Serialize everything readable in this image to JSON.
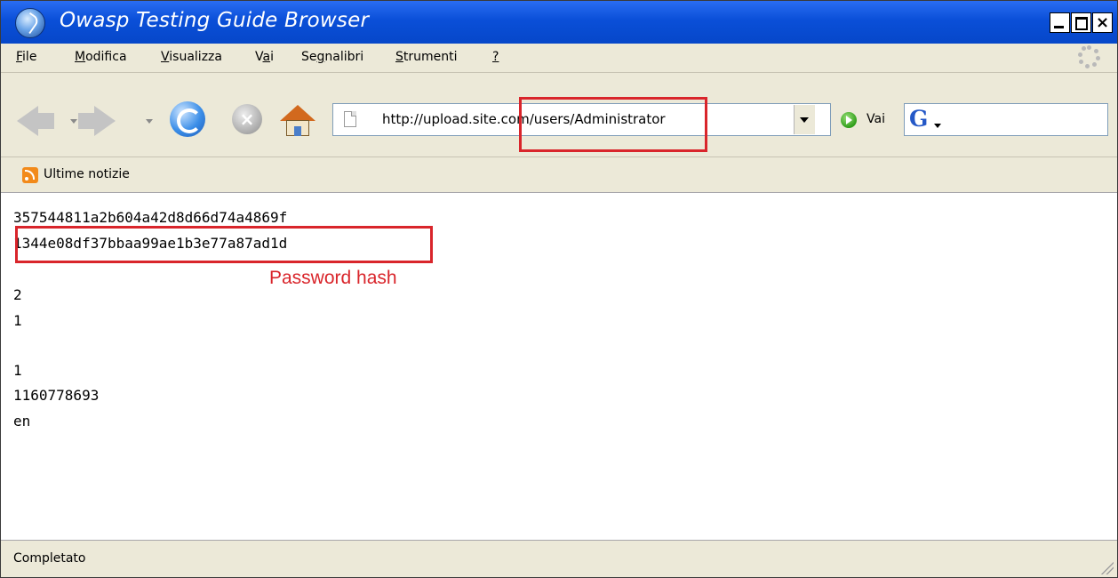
{
  "window": {
    "title": "Owasp Testing Guide Browser"
  },
  "menu": {
    "items": [
      {
        "label": "File",
        "accel": "F",
        "rest": "ile"
      },
      {
        "label": "Modifica",
        "accel": "M",
        "rest": "odifica"
      },
      {
        "label": "Visualizza",
        "accel": "V",
        "rest": "isualizza"
      },
      {
        "label": "Vai",
        "pre": "V",
        "accel": "a",
        "rest": "i"
      },
      {
        "label": "Segnalibri",
        "pre": "Se",
        "accel": "g",
        "rest": "nalibri"
      },
      {
        "label": "Strumenti",
        "accel": "S",
        "rest": "trumenti"
      },
      {
        "label": "?",
        "accel": "?",
        "rest": ""
      }
    ]
  },
  "nav": {
    "url": "http://upload.site.com/users/Administrator",
    "go_label": "Vai"
  },
  "bookmarks": {
    "item": "Ultime notizie"
  },
  "content": {
    "lines": [
      "357544811a2b604a42d8d66d74a4869f",
      "1344e08df37bbaa99ae1b3e77a87ad1d",
      "",
      "2",
      "1",
      "",
      "1",
      "1160778693",
      "en"
    ],
    "annotation": "Password hash"
  },
  "status": {
    "text": "Completato"
  },
  "colors": {
    "highlight": "#d9252b",
    "titlebar": "#0a4fd8"
  }
}
